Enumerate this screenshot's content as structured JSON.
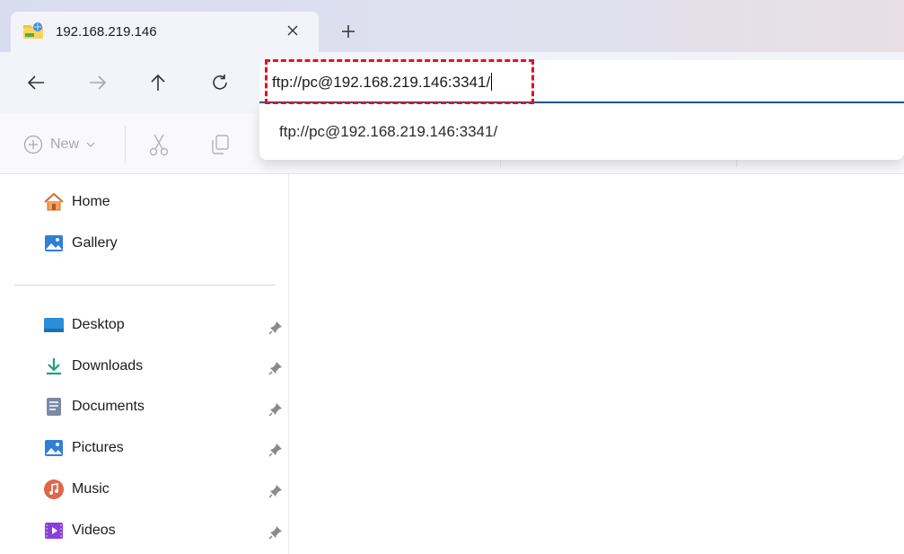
{
  "tab": {
    "title": "192.168.219.146",
    "icon": "ftp-folder-icon"
  },
  "address": {
    "value": "ftp://pc@192.168.219.146:3341/"
  },
  "suggestions": [
    {
      "label": "ftp://pc@192.168.219.146:3341/"
    }
  ],
  "toolbar": {
    "new_label": "New"
  },
  "sidebar": {
    "top_items": [
      {
        "label": "Home",
        "icon": "home-icon"
      },
      {
        "label": "Gallery",
        "icon": "gallery-icon"
      }
    ],
    "quick_access": [
      {
        "label": "Desktop",
        "icon": "desktop-icon"
      },
      {
        "label": "Downloads",
        "icon": "downloads-icon"
      },
      {
        "label": "Documents",
        "icon": "documents-icon"
      },
      {
        "label": "Pictures",
        "icon": "pictures-icon"
      },
      {
        "label": "Music",
        "icon": "music-icon"
      },
      {
        "label": "Videos",
        "icon": "videos-icon"
      }
    ]
  },
  "colors": {
    "accent": "#1f5c9f",
    "highlight": "#e0141e"
  }
}
